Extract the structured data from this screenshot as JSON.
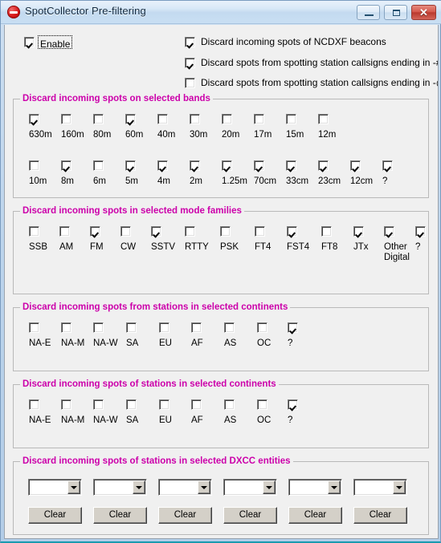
{
  "window": {
    "title": "SpotCollector Pre-filtering",
    "icon": "block-prohibited-icon",
    "accent_magenta": "#cc00aa",
    "titlebar_buttons": {
      "minimize": "Minimize",
      "maximize": "Maximize",
      "close": "Close",
      "close_glyph": "✕"
    }
  },
  "top": {
    "enable": {
      "label": "Enable",
      "checked": true
    },
    "options": [
      {
        "label": "Discard incoming spots of NCDXF beacons",
        "checked": true
      },
      {
        "label": "Discard spots from spotting station callsigns ending in -#",
        "checked": true
      },
      {
        "label": "Discard spots from spotting station callsigns ending in -@",
        "checked": false
      }
    ]
  },
  "bands": {
    "title": "Discard incoming spots on selected bands",
    "row1": [
      {
        "label": "630m",
        "checked": true
      },
      {
        "label": "160m",
        "checked": false
      },
      {
        "label": "80m",
        "checked": false
      },
      {
        "label": "60m",
        "checked": true
      },
      {
        "label": "40m",
        "checked": false
      },
      {
        "label": "30m",
        "checked": false
      },
      {
        "label": "20m",
        "checked": false
      },
      {
        "label": "17m",
        "checked": false
      },
      {
        "label": "15m",
        "checked": false
      },
      {
        "label": "12m",
        "checked": false
      }
    ],
    "row2": [
      {
        "label": "10m",
        "checked": false
      },
      {
        "label": "8m",
        "checked": true
      },
      {
        "label": "6m",
        "checked": false
      },
      {
        "label": "5m",
        "checked": true
      },
      {
        "label": "4m",
        "checked": true
      },
      {
        "label": "2m",
        "checked": true
      },
      {
        "label": "1.25m",
        "checked": true
      },
      {
        "label": "70cm",
        "checked": true
      },
      {
        "label": "33cm",
        "checked": true
      },
      {
        "label": "23cm",
        "checked": true
      },
      {
        "label": "12cm",
        "checked": true
      },
      {
        "label": "?",
        "checked": true
      }
    ]
  },
  "modes": {
    "title": "Discard incoming spots in selected mode families",
    "items": [
      {
        "label": "SSB",
        "label2": "",
        "checked": false
      },
      {
        "label": "AM",
        "label2": "",
        "checked": false
      },
      {
        "label": "FM",
        "label2": "",
        "checked": true
      },
      {
        "label": "CW",
        "label2": "",
        "checked": false
      },
      {
        "label": "SSTV",
        "label2": "",
        "checked": true
      },
      {
        "label": "RTTY",
        "label2": "",
        "checked": false
      },
      {
        "label": "PSK",
        "label2": "",
        "checked": false
      },
      {
        "label": "FT4",
        "label2": "",
        "checked": false
      },
      {
        "label": "FST4",
        "label2": "",
        "checked": true
      },
      {
        "label": "FT8",
        "label2": "",
        "checked": false
      },
      {
        "label": "JTx",
        "label2": "",
        "checked": true
      },
      {
        "label": "Other",
        "label2": "Digital",
        "checked": true
      },
      {
        "label": "?",
        "label2": "",
        "checked": true
      }
    ]
  },
  "continents_from": {
    "title": "Discard incoming spots from stations in selected continents",
    "items": [
      {
        "label": "NA-E",
        "checked": false
      },
      {
        "label": "NA-M",
        "checked": false
      },
      {
        "label": "NA-W",
        "checked": false
      },
      {
        "label": "SA",
        "checked": false
      },
      {
        "label": "EU",
        "checked": false
      },
      {
        "label": "AF",
        "checked": false
      },
      {
        "label": "AS",
        "checked": false
      },
      {
        "label": "OC",
        "checked": false
      },
      {
        "label": "?",
        "checked": true
      }
    ]
  },
  "continents_of": {
    "title": "Discard incoming spots of stations in selected continents",
    "items": [
      {
        "label": "NA-E",
        "checked": false
      },
      {
        "label": "NA-M",
        "checked": false
      },
      {
        "label": "NA-W",
        "checked": false
      },
      {
        "label": "SA",
        "checked": false
      },
      {
        "label": "EU",
        "checked": false
      },
      {
        "label": "AF",
        "checked": false
      },
      {
        "label": "AS",
        "checked": false
      },
      {
        "label": "OC",
        "checked": false
      },
      {
        "label": "?",
        "checked": true
      }
    ]
  },
  "dxcc": {
    "title": "Discard incoming spots of stations in selected DXCC entities",
    "clear_label": "Clear",
    "selectors": [
      {
        "value": ""
      },
      {
        "value": ""
      },
      {
        "value": ""
      },
      {
        "value": ""
      },
      {
        "value": ""
      },
      {
        "value": ""
      }
    ]
  }
}
